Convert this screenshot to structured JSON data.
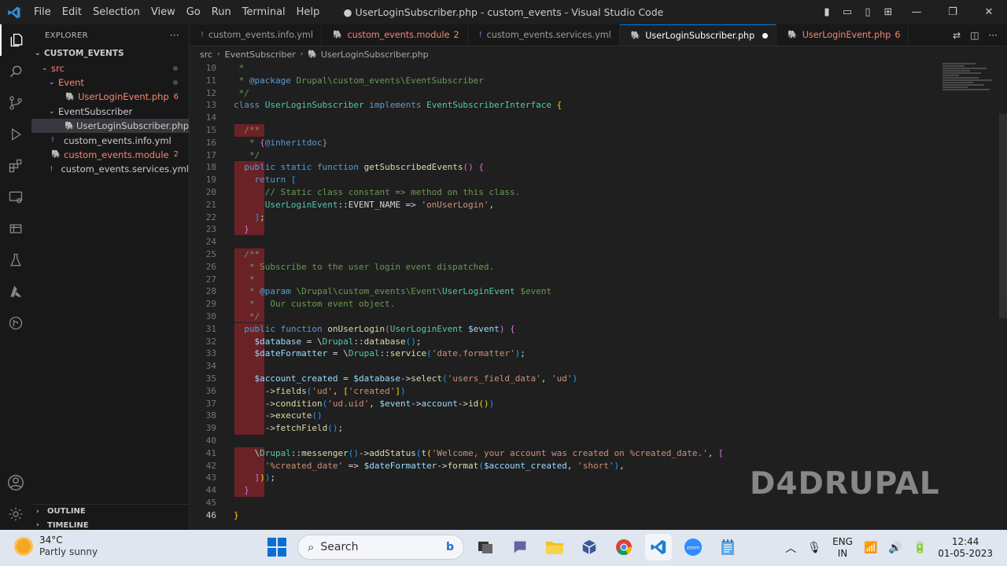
{
  "window": {
    "title": "● UserLoginSubscriber.php - custom_events - Visual Studio Code",
    "menu": [
      "File",
      "Edit",
      "Selection",
      "View",
      "Go",
      "Run",
      "Terminal",
      "Help"
    ]
  },
  "explorer": {
    "header": "EXPLORER",
    "more": "···",
    "root": "CUSTOM_EVENTS",
    "items": [
      {
        "label": "src",
        "indent": 1,
        "type": "folder",
        "state": "error-dot"
      },
      {
        "label": "Event",
        "indent": 2,
        "type": "folder",
        "state": "error-dot"
      },
      {
        "label": "UserLoginEvent.php",
        "indent": 3,
        "type": "php",
        "badge": "6",
        "state": "error"
      },
      {
        "label": "EventSubscriber",
        "indent": 2,
        "type": "folder",
        "state": "normal"
      },
      {
        "label": "UserLoginSubscriber.php",
        "indent": 3,
        "type": "php",
        "state": "selected"
      },
      {
        "label": "custom_events.info.yml",
        "indent": 1,
        "type": "yml",
        "state": "normal"
      },
      {
        "label": "custom_events.module",
        "indent": 1,
        "type": "php",
        "badge": "2",
        "state": "error"
      },
      {
        "label": "custom_events.services.yml",
        "indent": 1,
        "type": "yml",
        "state": "normal"
      }
    ],
    "outline": "OUTLINE",
    "timeline": "TIMELINE"
  },
  "tabs": [
    {
      "label": "custom_events.info.yml",
      "icon": "!",
      "state": "normal",
      "badge": ""
    },
    {
      "label": "custom_events.module",
      "icon": "php",
      "state": "error",
      "badge": "2"
    },
    {
      "label": "custom_events.services.yml",
      "icon": "!",
      "state": "normal",
      "badge": ""
    },
    {
      "label": "UserLoginSubscriber.php",
      "icon": "php",
      "state": "active",
      "badge": ""
    },
    {
      "label": "UserLoginEvent.php",
      "icon": "php",
      "state": "error",
      "badge": "6"
    }
  ],
  "breadcrumb": [
    "src",
    "EventSubscriber",
    "UserLoginSubscriber.php"
  ],
  "editor": {
    "current_line": 46,
    "lines": [
      {
        "n": 10,
        "html": "<span class=\"doc\"> *</span>"
      },
      {
        "n": 11,
        "html": "<span class=\"doc\"> * </span><span class=\"tag\">@package</span><span class=\"doc\"> Drupal\\custom_events\\EventSubscriber</span>"
      },
      {
        "n": 12,
        "html": "<span class=\"doc\"> */</span>"
      },
      {
        "n": 13,
        "html": "<span class=\"kw\">class</span> <span class=\"cls\">UserLoginSubscriber</span> <span class=\"kw\">implements</span> <span class=\"cls\">EventSubscriberInterface</span> <span class=\"br1\">{</span>"
      },
      {
        "n": 14,
        "html": ""
      },
      {
        "n": 15,
        "html": "  <span class=\"doc\">/**</span>"
      },
      {
        "n": 16,
        "html": "  <span class=\"doc\"> * </span><span class=\"br2\">{</span><span class=\"tag\">@inheritdoc</span><span class=\"br2\">}</span>"
      },
      {
        "n": 17,
        "html": "  <span class=\"doc\"> */</span>"
      },
      {
        "n": 18,
        "html": "  <span class=\"kw\">public</span> <span class=\"kw\">static</span> <span class=\"kw\">function</span> <span class=\"fn\">getSubscribedEvents</span><span class=\"br2\">()</span> <span class=\"br2\">{</span>"
      },
      {
        "n": 19,
        "html": "    <span class=\"kw\">return</span> <span class=\"br3\">[</span>"
      },
      {
        "n": 20,
        "html": "      <span class=\"cm\">// Static class constant =&gt; method on this class.</span>"
      },
      {
        "n": 21,
        "html": "      <span class=\"cls\">UserLoginEvent</span>::EVENT_NAME =&gt; <span class=\"str\">'onUserLogin'</span>,"
      },
      {
        "n": 22,
        "html": "    <span class=\"br3\">]</span>;"
      },
      {
        "n": 23,
        "html": "  <span class=\"br2\">}</span>"
      },
      {
        "n": 24,
        "html": ""
      },
      {
        "n": 25,
        "html": "  <span class=\"doc\">/**</span>"
      },
      {
        "n": 26,
        "html": "  <span class=\"doc\"> * Subscribe to the user login event dispatched.</span>"
      },
      {
        "n": 27,
        "html": "  <span class=\"doc\"> *</span>"
      },
      {
        "n": 28,
        "html": "  <span class=\"doc\"> * </span><span class=\"tag\">@param</span> <span class=\"doc\">\\Drupal\\custom_events\\Event\\</span><span class=\"cls\">UserLoginEvent</span> <span class=\"doc\">$event</span>"
      },
      {
        "n": 29,
        "html": "  <span class=\"doc\"> *   Our custom event object.</span>"
      },
      {
        "n": 30,
        "html": "  <span class=\"doc\"> */</span>"
      },
      {
        "n": 31,
        "html": "  <span class=\"kw\">public</span> <span class=\"kw\">function</span> <span class=\"fn\">onUserLogin</span><span class=\"br2\">(</span><span class=\"cls\">UserLoginEvent</span> <span class=\"var\">$event</span><span class=\"br2\">)</span> <span class=\"br2\">{</span>"
      },
      {
        "n": 32,
        "html": "    <span class=\"var\">$database</span> = \\<span class=\"cls\">Drupal</span>::<span class=\"fn\">database</span><span class=\"br3\">()</span>;"
      },
      {
        "n": 33,
        "html": "    <span class=\"var\">$dateFormatter</span> = \\<span class=\"cls\">Drupal</span>::<span class=\"fn\">service</span><span class=\"br3\">(</span><span class=\"str\">'date.formatter'</span><span class=\"br3\">)</span>;"
      },
      {
        "n": 34,
        "html": ""
      },
      {
        "n": 35,
        "html": "    <span class=\"var\">$account_created</span> = <span class=\"var\">$database</span>-&gt;<span class=\"fn\">select</span><span class=\"br3\">(</span><span class=\"str\">'users_field_data'</span>, <span class=\"str\">'ud'</span><span class=\"br3\">)</span>"
      },
      {
        "n": 36,
        "html": "      -&gt;<span class=\"fn\">fields</span><span class=\"br3\">(</span><span class=\"str\">'ud'</span>, <span class=\"br1\">[</span><span class=\"str\">'created'</span><span class=\"br1\">]</span><span class=\"br3\">)</span>"
      },
      {
        "n": 37,
        "html": "      -&gt;<span class=\"fn\">condition</span><span class=\"br3\">(</span><span class=\"str\">'ud.uid'</span>, <span class=\"var\">$event</span>-&gt;<span class=\"var\">account</span>-&gt;<span class=\"fn\">id</span><span class=\"br1\">()</span><span class=\"br3\">)</span>"
      },
      {
        "n": 38,
        "html": "      -&gt;<span class=\"fn\">execute</span><span class=\"br3\">()</span>"
      },
      {
        "n": 39,
        "html": "      -&gt;<span class=\"fn\">fetchField</span><span class=\"br3\">()</span>;"
      },
      {
        "n": 40,
        "html": ""
      },
      {
        "n": 41,
        "html": "    \\<span class=\"cls\">Drupal</span>::<span class=\"fn\">messenger</span><span class=\"br3\">()</span>-&gt;<span class=\"fn\">addStatus</span><span class=\"br3\">(</span><span class=\"fn\">t</span><span class=\"br1\">(</span><span class=\"str\">'Welcome, your account was created on %created_date.'</span>, <span class=\"br2\">[</span>"
      },
      {
        "n": 42,
        "html": "      <span class=\"str\">'%created_date'</span> =&gt; <span class=\"var\">$dateFormatter</span>-&gt;<span class=\"fn\">format</span><span class=\"br3\">(</span><span class=\"var\">$account_created</span>, <span class=\"str\">'short'</span><span class=\"br3\">)</span>,"
      },
      {
        "n": 43,
        "html": "    <span class=\"br2\">]</span><span class=\"br1\">)</span><span class=\"br3\">)</span>;"
      },
      {
        "n": 44,
        "html": "  <span class=\"br2\">}</span>"
      },
      {
        "n": 45,
        "html": ""
      },
      {
        "n": 46,
        "html": "<span class=\"br1\">}</span>"
      }
    ]
  },
  "watermark": "D4DRUPAL",
  "taskbar": {
    "temp": "34°C",
    "condition": "Partly sunny",
    "search_placeholder": "Search",
    "lang_line1": "ENG",
    "lang_line2": "IN",
    "time": "12:44",
    "date": "01-05-2023"
  },
  "colors": {
    "accent": "#0078d4",
    "error": "#f48771",
    "editor_bg": "#1f1f1f"
  }
}
